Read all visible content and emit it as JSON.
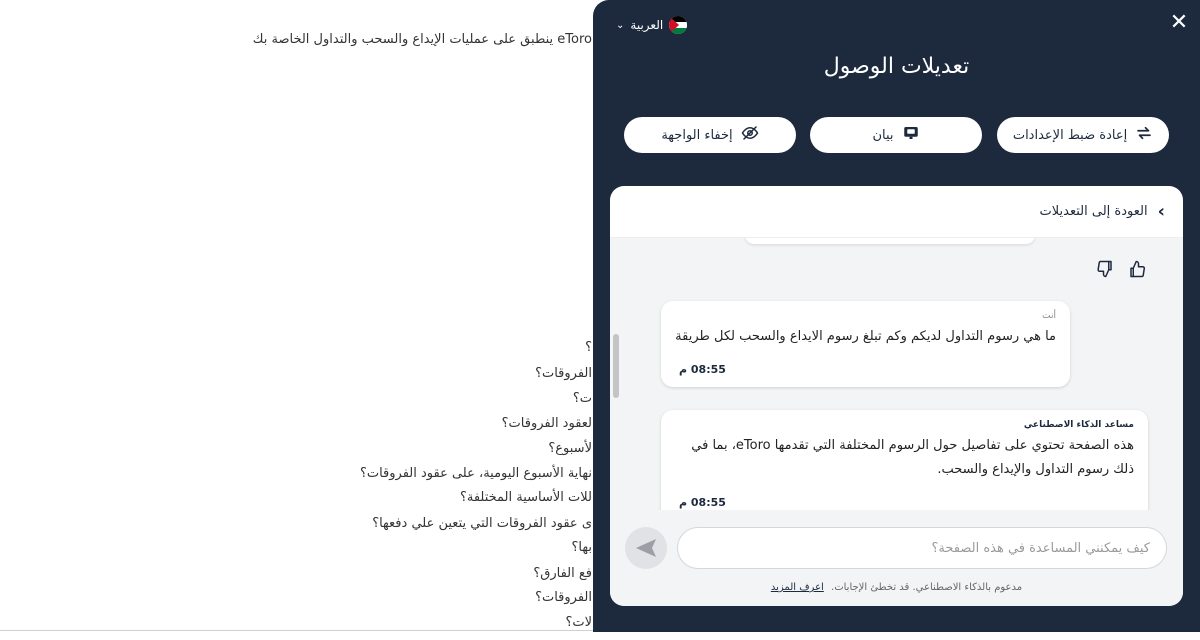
{
  "background": {
    "intro": "eToro ينطبق على عمليات الإيداع والسحب والتداول الخاصة بك",
    "questions": [
      "؟",
      "الفروقات؟",
      "ت؟",
      "لعقود الفروقات؟",
      "لأسبوع؟",
      "نهاية الأسبوع اليومية، على عقود الفروقات؟",
      "للات الأساسية المختلفة؟",
      "ى عقود الفروقات التي يتعين علي دفعها؟",
      "بها؟",
      "فع الفارق؟",
      "الفروقات؟",
      "لات؟"
    ]
  },
  "panel": {
    "language_label": "العربية",
    "title": "تعديلات الوصول",
    "buttons": {
      "reset": "إعادة ضبط الإعدادات",
      "statement": "بيان",
      "hide": "إخفاء الواجهة"
    },
    "back_label": "العودة إلى التعديلات",
    "messages": {
      "user_sender": "أنت",
      "user_text": "ما هي رسوم التداول لديكم وكم تبلغ رسوم الايداع والسحب لكل طريقة",
      "user_time": "08:55 م",
      "ai_sender": "مساعد الذكاء الاصطناعي",
      "ai_text": "هذه الصفحة تحتوي على تفاصيل حول الرسوم المختلفة التي تقدمها eToro، بما في ذلك رسوم التداول والإيداع والسحب.",
      "ai_time": "08:55 م"
    },
    "input_placeholder": "كيف يمكنني المساعدة في هذه الصفحة؟",
    "footnote": "مدعوم بالذكاء الاصطناعي. قد تخطئ الإجابات.",
    "learn_more": "اعرف المزيد"
  },
  "colors": {
    "panel_bg": "#1d2a3e",
    "card_bg": "#ffffff",
    "chat_bg": "#f3f4f6"
  },
  "icons": [
    "jordan-flag-icon",
    "chevron-down-icon",
    "close-icon",
    "reset-arrows-icon",
    "statement-icon",
    "eye-off-icon",
    "chevron-right-icon",
    "thumbs-down-icon",
    "thumbs-up-icon",
    "send-icon"
  ]
}
